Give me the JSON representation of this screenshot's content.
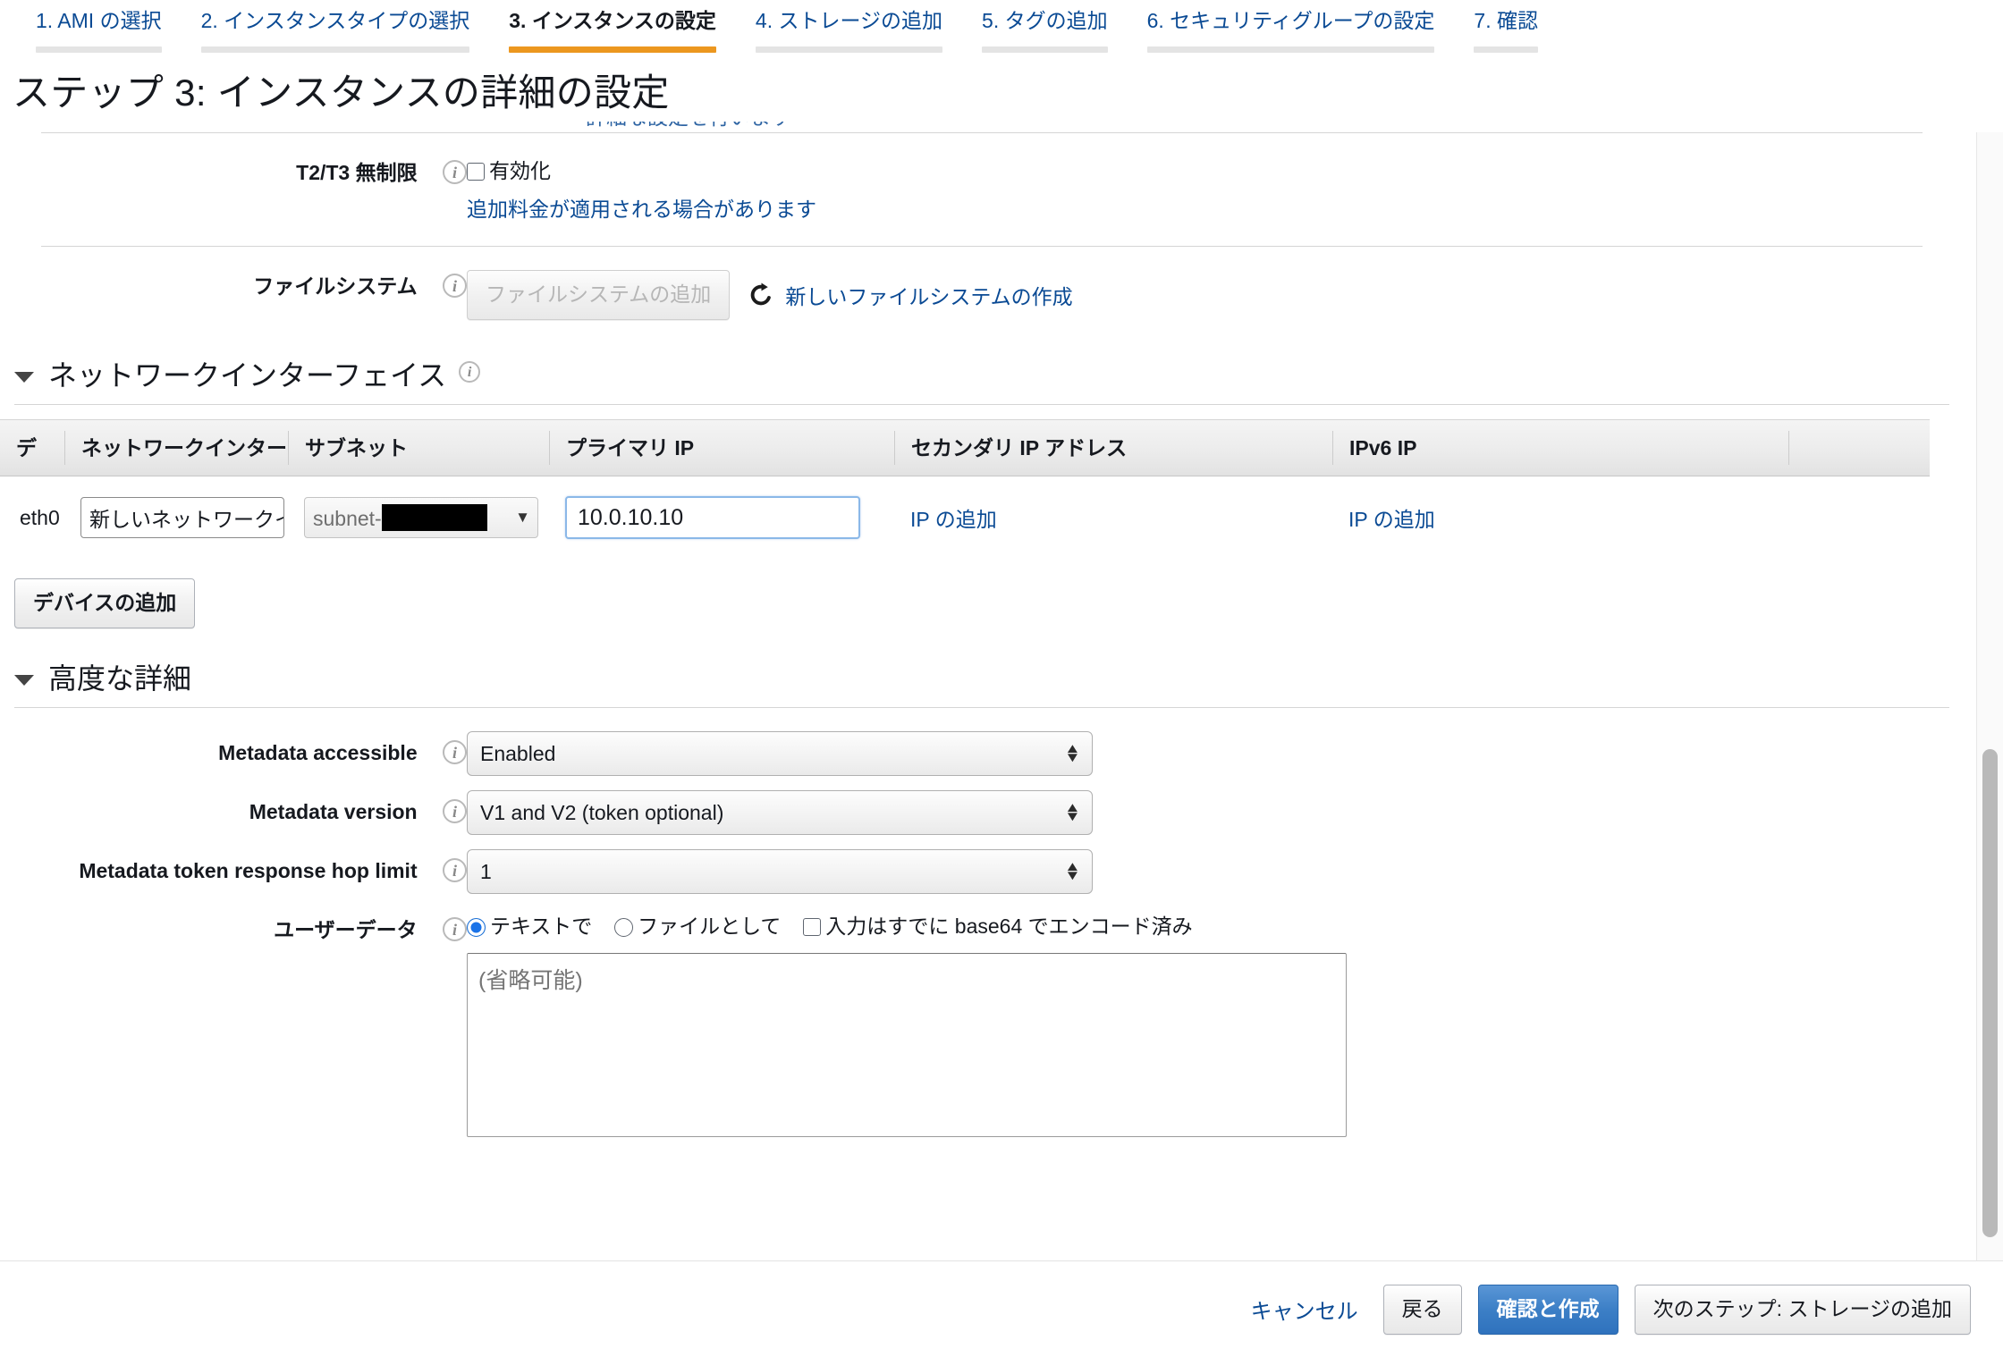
{
  "wizard": {
    "tabs": [
      {
        "label": "1. AMI の選択",
        "active": false
      },
      {
        "label": "2. インスタンスタイプの選択",
        "active": false
      },
      {
        "label": "3. インスタンスの設定",
        "active": true
      },
      {
        "label": "4. ストレージの追加",
        "active": false
      },
      {
        "label": "5. タグの追加",
        "active": false
      },
      {
        "label": "6. セキュリティグループの設定",
        "active": false
      },
      {
        "label": "7. 確認",
        "active": false
      }
    ],
    "active_accent": "#ec971f",
    "inactive_bar": "#e4e4e4"
  },
  "header": {
    "title": "ステップ 3: インスタンスの詳細の設定",
    "clipped_link": "詳細な設定を行います"
  },
  "t2t3": {
    "label": "T2/T3 無制限",
    "info": "i",
    "checkbox_label": "有効化",
    "checked": false,
    "note_link": "追加料金が適用される場合があります"
  },
  "filesystem": {
    "label": "ファイルシステム",
    "info": "i",
    "add_button": "ファイルシステムの追加",
    "add_button_disabled": true,
    "refresh_icon": "refresh-icon",
    "create_link": "新しいファイルシステムの作成"
  },
  "network_interfaces": {
    "section_title": "ネットワークインターフェイス",
    "info": "i",
    "expanded": true,
    "columns": [
      "デ",
      "ネットワークインターフ",
      "サブネット",
      "プライマリ IP",
      "セカンダリ IP アドレス",
      "IPv6 IP"
    ],
    "rows": [
      {
        "device": "eth0",
        "interface": "新しいネットワークイ",
        "subnet_prefix": "subnet-",
        "subnet_redacted": true,
        "primary_ip": "10.0.10.10",
        "secondary_ip_link": "IP の追加",
        "ipv6_link": "IP の追加"
      }
    ],
    "add_device_button": "デバイスの追加"
  },
  "advanced": {
    "section_title": "高度な詳細",
    "expanded": true,
    "rows": [
      {
        "label": "Metadata accessible",
        "info": "i",
        "value": "Enabled",
        "type": "select"
      },
      {
        "label": "Metadata version",
        "info": "i",
        "value": "V1 and V2 (token optional)",
        "type": "select"
      },
      {
        "label": "Metadata token response hop limit",
        "info": "i",
        "value": "1",
        "type": "select"
      }
    ],
    "userdata": {
      "label": "ユーザーデータ",
      "info": "i",
      "radio_text": "テキストで",
      "radio_file": "ファイルとして",
      "radio_selected": "テキストで",
      "base64_label": "入力はすでに base64 でエンコード済み",
      "base64_checked": false,
      "textarea_placeholder": "(省略可能)",
      "textarea_value": ""
    }
  },
  "footer": {
    "cancel": "キャンセル",
    "back": "戻る",
    "review_and_launch": "確認と作成",
    "next_step": "次のステップ: ストレージの追加",
    "primary_color": "#3c7fc6"
  },
  "scrollbar": {
    "vertical_thumb_visible": true
  }
}
